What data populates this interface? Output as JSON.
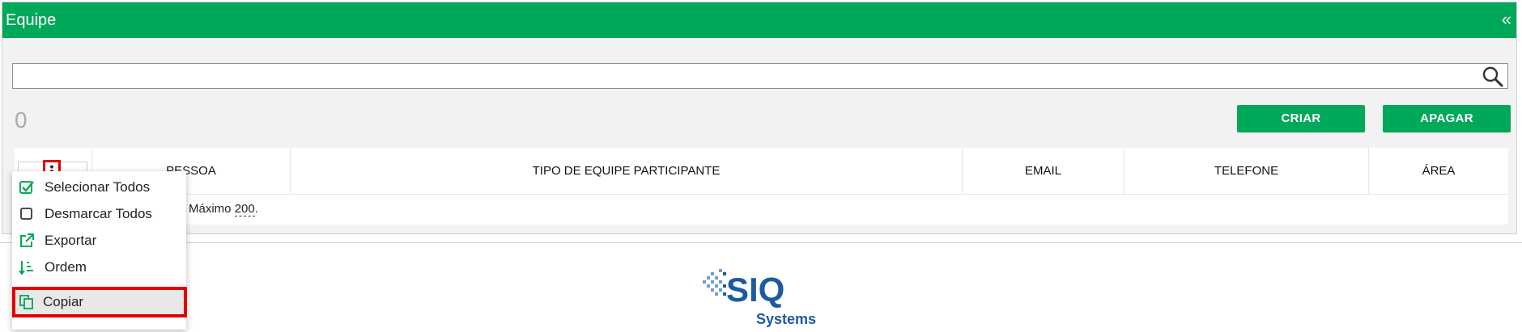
{
  "header": {
    "title": "Equipe",
    "collapse_glyph": "«"
  },
  "search": {
    "value": "",
    "placeholder": "",
    "icon": "search-icon"
  },
  "count": "0",
  "buttons": {
    "create": "CRIAR",
    "delete": "APAGAR"
  },
  "table": {
    "columns": [
      "PESSOA",
      "TIPO DE EQUIPE PARTICIPANTE",
      "EMAIL",
      "TELEFONE",
      "ÁREA"
    ],
    "footer_prefix": "Máximo",
    "footer_max": "200",
    "footer_suffix": "."
  },
  "menu": {
    "items": [
      {
        "label": "Selecionar Todos",
        "icon": "checked-box-icon"
      },
      {
        "label": "Desmarcar Todos",
        "icon": "empty-box-icon"
      },
      {
        "label": "Exportar",
        "icon": "external-link-icon"
      },
      {
        "label": "Ordem",
        "icon": "sort-order-icon"
      }
    ],
    "copy": {
      "label": "Copiar",
      "icon": "copy-icon"
    }
  },
  "logo": {
    "text": "SIQ",
    "subtext": "Systems"
  },
  "colors": {
    "brand_green": "#00a85a",
    "highlight_red": "#e00000",
    "logo_blue": "#1d5aa0"
  }
}
